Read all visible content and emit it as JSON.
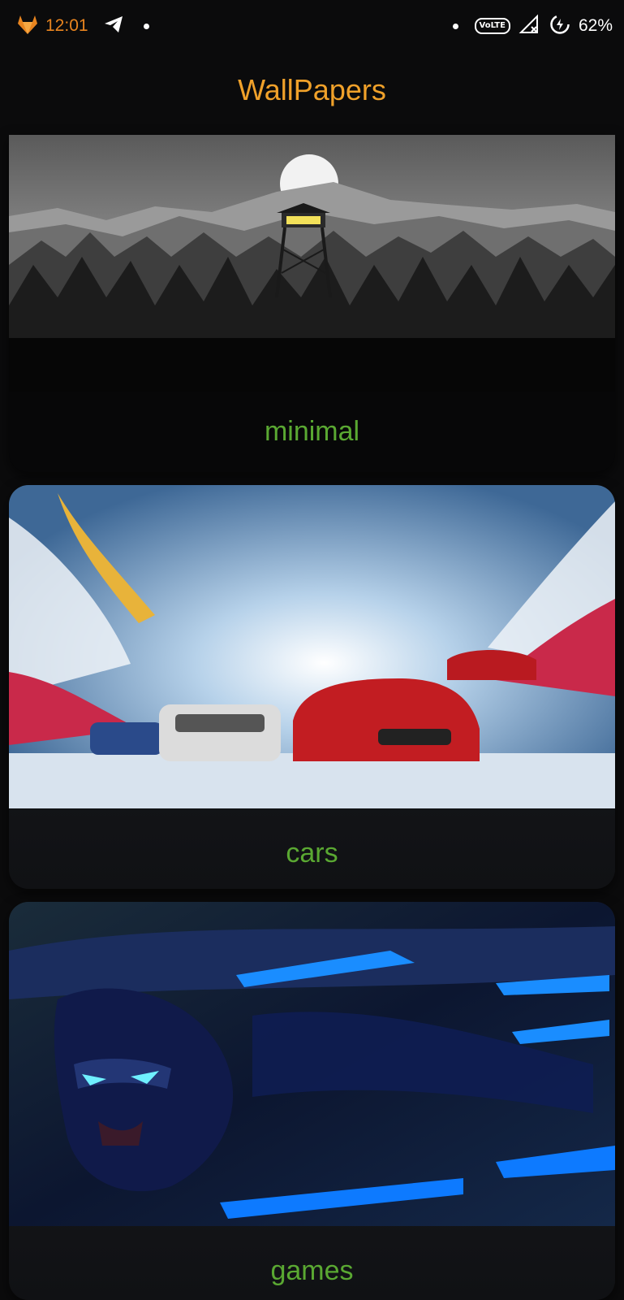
{
  "status_bar": {
    "time": "12:01",
    "battery": "62%",
    "network_badge": "VoLTE",
    "app_icon": "gitlab-fox-icon",
    "notification_icon": "telegram-icon",
    "status_icons": [
      "signal-no-service-icon",
      "battery-charging-icon"
    ]
  },
  "app": {
    "title": "WallPapers"
  },
  "categories": [
    {
      "label": "minimal",
      "image": "fire-lookout-tower-mountains-monochrome"
    },
    {
      "label": "cars",
      "image": "red-mercedes-cars-racing-illustration"
    },
    {
      "label": "games",
      "image": "blue-neon-warrior-dash"
    }
  ],
  "colors": {
    "title": "#f0a12a",
    "label": "#5aa832",
    "background": "#0b0b0c",
    "time": "#e8841f"
  }
}
